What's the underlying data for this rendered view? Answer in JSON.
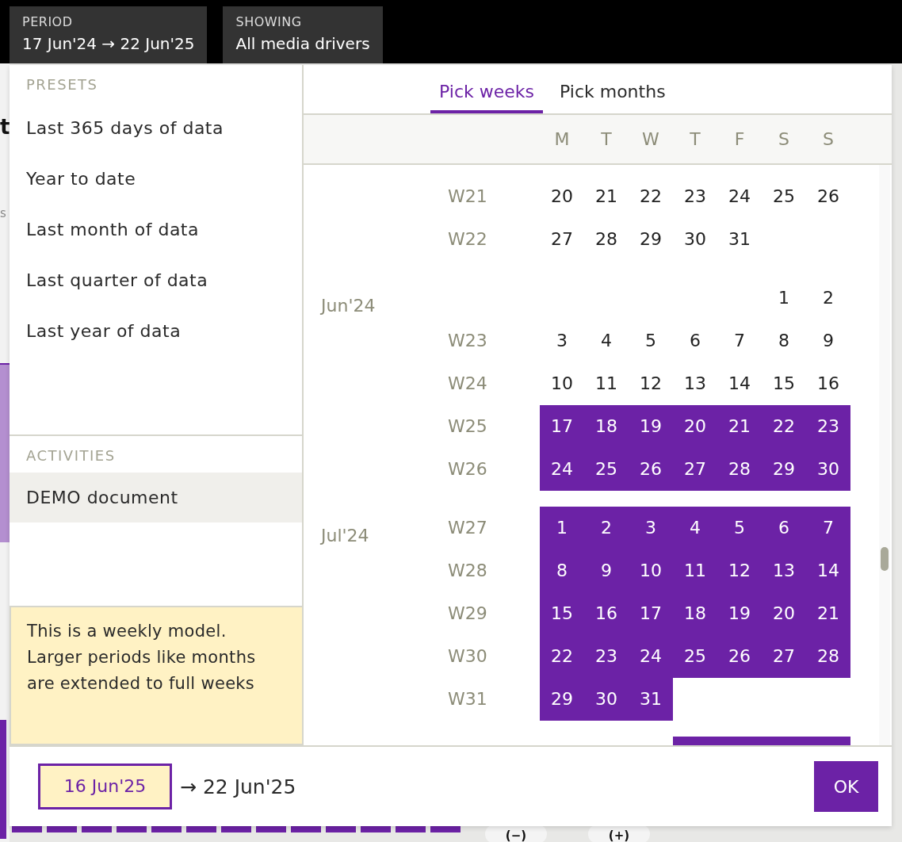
{
  "top_bar": {
    "chips": [
      {
        "label": "PERIOD",
        "value": "17 Jun'24 → 22 Jun'25"
      },
      {
        "label": "SHOWING",
        "value": "All media drivers"
      }
    ]
  },
  "background": {
    "heading_fragment": "t",
    "subtitle_fragment": "s",
    "zoom_buttons": [
      "(−)",
      "(+)"
    ]
  },
  "period_picker": {
    "presets": {
      "title": "PRESETS",
      "items": [
        "Last 365 days of data",
        "Year to date",
        "Last month of data",
        "Last quarter of data",
        "Last year of data"
      ]
    },
    "activities": {
      "title": "ACTIVITIES",
      "items": [
        {
          "label": "DEMO document",
          "selected": true
        }
      ]
    },
    "note": "This is a weekly model. Larger periods like months are extended to full weeks",
    "tabs": [
      {
        "label": "Pick weeks",
        "selected": true
      },
      {
        "label": "Pick months",
        "selected": false
      }
    ],
    "weekdays": [
      "M",
      "T",
      "W",
      "T",
      "F",
      "S",
      "S"
    ],
    "months": [
      {
        "rows": [
          {
            "week": "W21",
            "days": [
              {
                "day": "20",
                "selected": false
              },
              {
                "day": "21",
                "selected": false
              },
              {
                "day": "22",
                "selected": false
              },
              {
                "day": "23",
                "selected": false
              },
              {
                "day": "24",
                "selected": false
              },
              {
                "day": "25",
                "selected": false
              },
              {
                "day": "26",
                "selected": false
              }
            ]
          },
          {
            "week": "W22",
            "days": [
              {
                "day": "27",
                "selected": false
              },
              {
                "day": "28",
                "selected": false
              },
              {
                "day": "29",
                "selected": false
              },
              {
                "day": "30",
                "selected": false
              },
              {
                "day": "31",
                "selected": false
              }
            ]
          }
        ]
      },
      {
        "label": "Jun'24",
        "rows": [
          {
            "flush_right": true,
            "days": [
              {
                "day": "1",
                "selected": false
              },
              {
                "day": "2",
                "selected": false
              }
            ]
          },
          {
            "week": "W23",
            "days": [
              {
                "day": "3",
                "selected": false
              },
              {
                "day": "4",
                "selected": false
              },
              {
                "day": "5",
                "selected": false
              },
              {
                "day": "6",
                "selected": false
              },
              {
                "day": "7",
                "selected": false
              },
              {
                "day": "8",
                "selected": false
              },
              {
                "day": "9",
                "selected": false
              }
            ]
          },
          {
            "week": "W24",
            "days": [
              {
                "day": "10",
                "selected": false
              },
              {
                "day": "11",
                "selected": false
              },
              {
                "day": "12",
                "selected": false
              },
              {
                "day": "13",
                "selected": false
              },
              {
                "day": "14",
                "selected": false
              },
              {
                "day": "15",
                "selected": false
              },
              {
                "day": "16",
                "selected": false
              }
            ]
          },
          {
            "week": "W25",
            "days": [
              {
                "day": "17",
                "selected": true
              },
              {
                "day": "18",
                "selected": true
              },
              {
                "day": "19",
                "selected": true
              },
              {
                "day": "20",
                "selected": true
              },
              {
                "day": "21",
                "selected": true
              },
              {
                "day": "22",
                "selected": true
              },
              {
                "day": "23",
                "selected": true
              }
            ]
          },
          {
            "week": "W26",
            "days": [
              {
                "day": "24",
                "selected": true
              },
              {
                "day": "25",
                "selected": true
              },
              {
                "day": "26",
                "selected": true
              },
              {
                "day": "27",
                "selected": true
              },
              {
                "day": "28",
                "selected": true
              },
              {
                "day": "29",
                "selected": true
              },
              {
                "day": "30",
                "selected": true
              }
            ]
          }
        ]
      },
      {
        "label": "Jul'24",
        "rows": [
          {
            "week": "W27",
            "days": [
              {
                "day": "1",
                "selected": true
              },
              {
                "day": "2",
                "selected": true
              },
              {
                "day": "3",
                "selected": true
              },
              {
                "day": "4",
                "selected": true
              },
              {
                "day": "5",
                "selected": true
              },
              {
                "day": "6",
                "selected": true
              },
              {
                "day": "7",
                "selected": true
              }
            ]
          },
          {
            "week": "W28",
            "days": [
              {
                "day": "8",
                "selected": true
              },
              {
                "day": "9",
                "selected": true
              },
              {
                "day": "10",
                "selected": true
              },
              {
                "day": "11",
                "selected": true
              },
              {
                "day": "12",
                "selected": true
              },
              {
                "day": "13",
                "selected": true
              },
              {
                "day": "14",
                "selected": true
              }
            ]
          },
          {
            "week": "W29",
            "days": [
              {
                "day": "15",
                "selected": true
              },
              {
                "day": "16",
                "selected": true
              },
              {
                "day": "17",
                "selected": true
              },
              {
                "day": "18",
                "selected": true
              },
              {
                "day": "19",
                "selected": true
              },
              {
                "day": "20",
                "selected": true
              },
              {
                "day": "21",
                "selected": true
              }
            ]
          },
          {
            "week": "W30",
            "days": [
              {
                "day": "22",
                "selected": true
              },
              {
                "day": "23",
                "selected": true
              },
              {
                "day": "24",
                "selected": true
              },
              {
                "day": "25",
                "selected": true
              },
              {
                "day": "26",
                "selected": true
              },
              {
                "day": "27",
                "selected": true
              },
              {
                "day": "28",
                "selected": true
              }
            ]
          },
          {
            "week": "W31",
            "days": [
              {
                "day": "29",
                "selected": true
              },
              {
                "day": "30",
                "selected": true
              },
              {
                "day": "31",
                "selected": true
              }
            ]
          }
        ]
      },
      {
        "rows": [
          {
            "flush_right": true,
            "days": [
              {
                "selected": true
              },
              {
                "selected": true
              },
              {
                "selected": true
              },
              {
                "selected": true
              }
            ]
          }
        ]
      }
    ],
    "start_date": "16 Jun'25",
    "end_date": "→ 22 Jun'25",
    "ok_button": "OK"
  }
}
